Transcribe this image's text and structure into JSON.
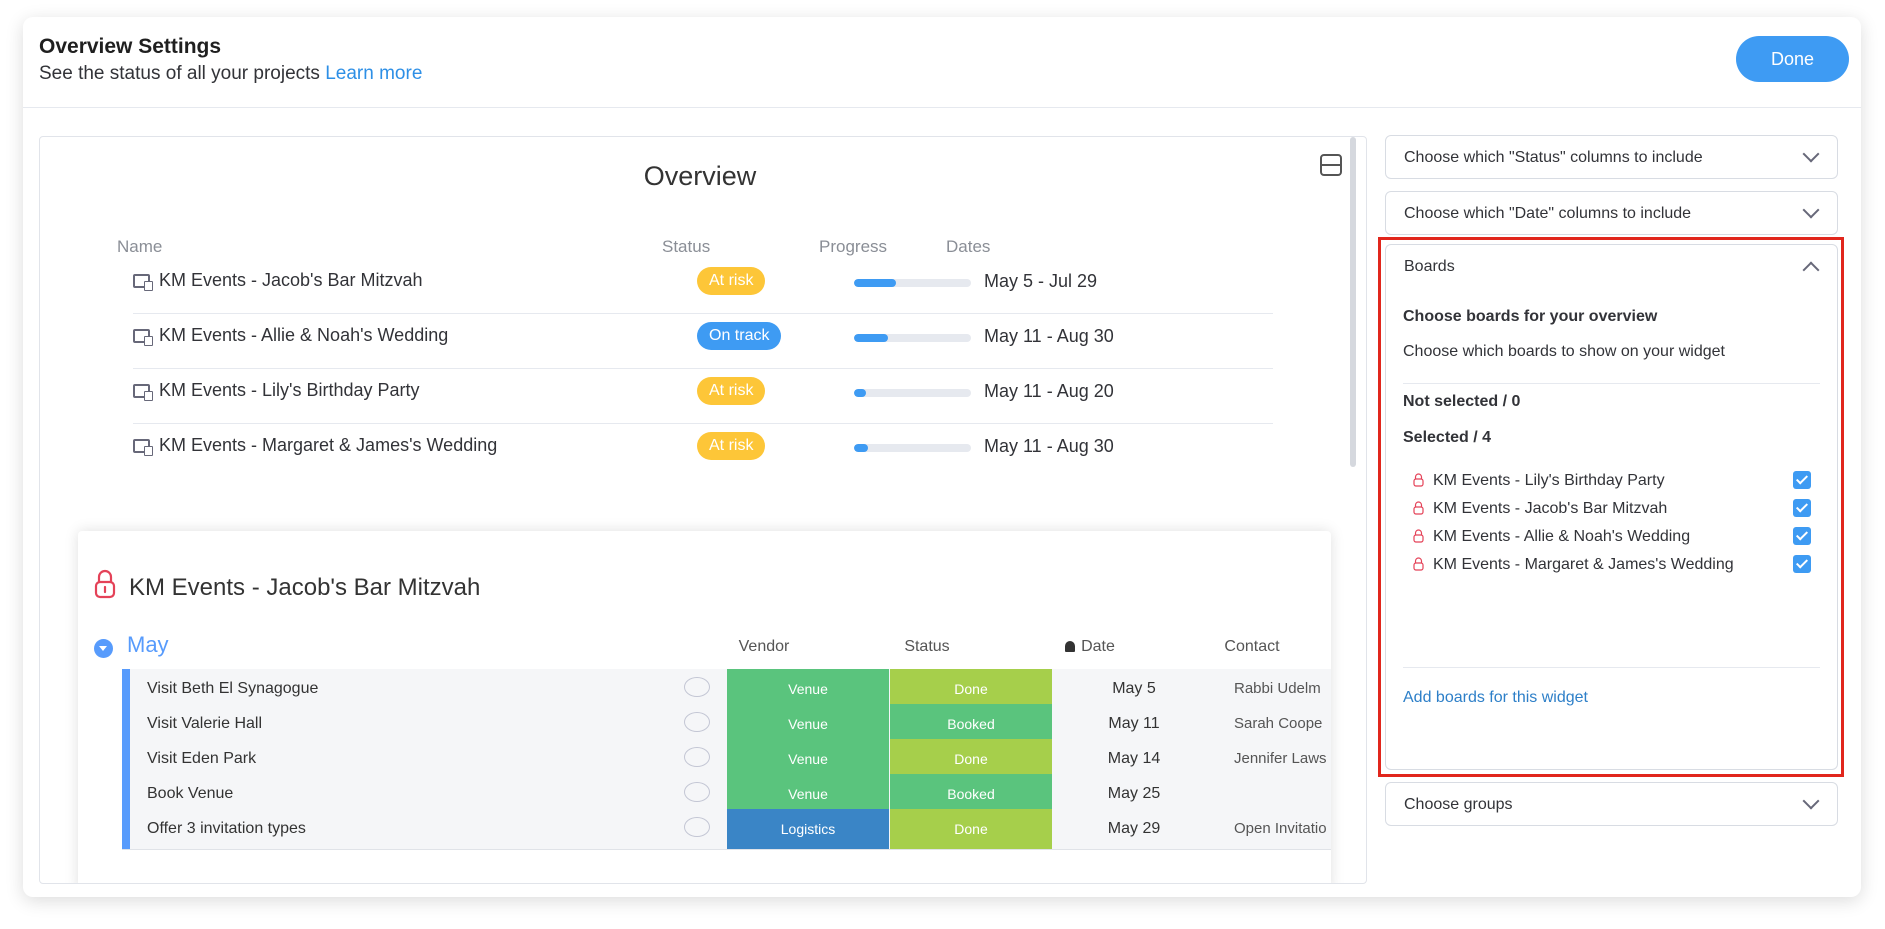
{
  "header": {
    "title": "Overview Settings",
    "subtitle": "See the status of all your projects",
    "learn_more": "Learn more",
    "done_label": "Done"
  },
  "overview": {
    "title": "Overview",
    "columns": {
      "name": "Name",
      "status": "Status",
      "progress": "Progress",
      "dates": "Dates"
    },
    "rows": [
      {
        "name": "KM Events - Jacob's Bar Mitzvah",
        "status": "At risk",
        "progress": 0.36,
        "dates": "May 5 - Jul 29"
      },
      {
        "name": "KM Events - Allie & Noah's Wedding",
        "status": "On track",
        "progress": 0.29,
        "dates": "May 11 - Aug 30"
      },
      {
        "name": "KM Events - Lily's Birthday Party",
        "status": "At risk",
        "progress": 0.1,
        "dates": "May 11 - Aug 20"
      },
      {
        "name": "KM Events - Margaret & James's Wedding",
        "status": "At risk",
        "progress": 0.12,
        "dates": "May 11 - Aug 30"
      }
    ]
  },
  "board": {
    "title": "KM Events - Jacob's Bar Mitzvah",
    "group": "May",
    "columns": {
      "vendor": "Vendor",
      "status": "Status",
      "date": "Date",
      "contact": "Contact"
    },
    "items": [
      {
        "name": "Visit Beth El Synagogue",
        "vendor": "Venue",
        "status": "Done",
        "date": "May 5",
        "contact": "Rabbi Udelm"
      },
      {
        "name": "Visit Valerie Hall",
        "vendor": "Venue",
        "status": "Booked",
        "date": "May 11",
        "contact": "Sarah Coope"
      },
      {
        "name": "Visit Eden Park",
        "vendor": "Venue",
        "status": "Done",
        "date": "May 14",
        "contact": "Jennifer Laws"
      },
      {
        "name": "Book Venue",
        "vendor": "Venue",
        "status": "Booked",
        "date": "May 25",
        "contact": ""
      },
      {
        "name": "Offer 3 invitation types",
        "vendor": "Logistics",
        "status": "Done",
        "date": "May 29",
        "contact": "Open Invitatio"
      }
    ]
  },
  "settings": {
    "status_columns": "Choose which \"Status\" columns to include",
    "date_columns": "Choose which \"Date\" columns to include",
    "boards": {
      "label": "Boards",
      "heading": "Choose boards for your overview",
      "description": "Choose which boards to show on your widget",
      "not_selected": "Not selected / 0",
      "selected": "Selected / 4",
      "items": [
        {
          "name": "KM Events - Lily's Birthday Party",
          "checked": true
        },
        {
          "name": "KM Events - Jacob's Bar Mitzvah",
          "checked": true
        },
        {
          "name": "KM Events - Allie & Noah's Wedding",
          "checked": true
        },
        {
          "name": "KM Events - Margaret & James's Wedding",
          "checked": true
        }
      ],
      "add_link": "Add boards for this widget"
    },
    "groups": "Choose groups"
  },
  "colors": {
    "primary": "#3e9bf3",
    "at_risk": "#fdc638",
    "highlight": "#e1261c",
    "venue": "#5ac47d",
    "logistics": "#3a85c6",
    "done": "#a6cf4b"
  }
}
